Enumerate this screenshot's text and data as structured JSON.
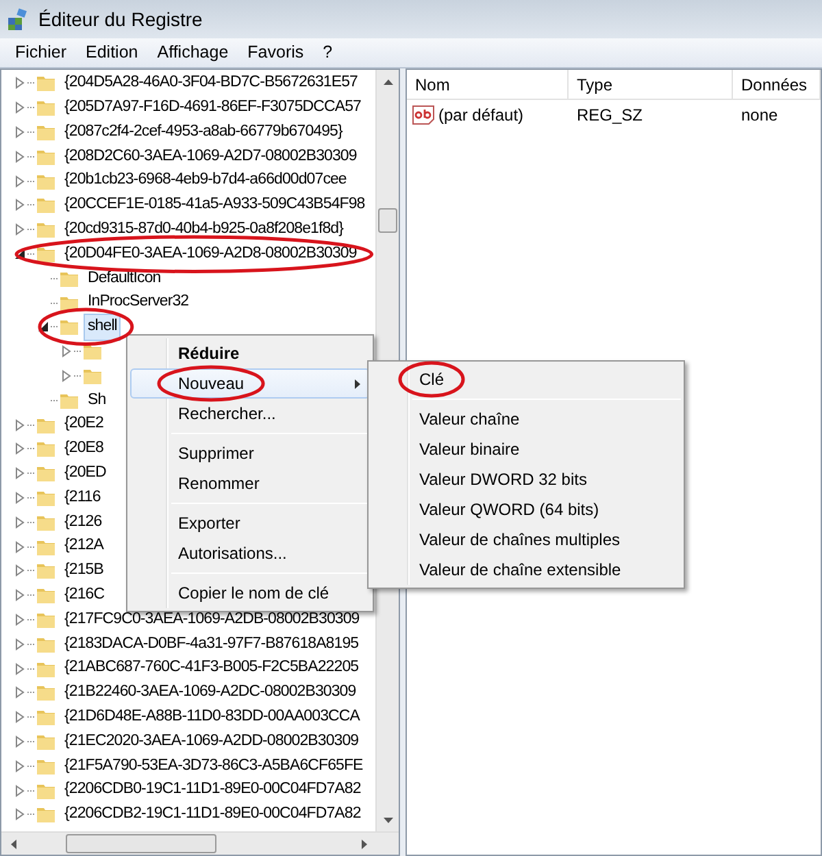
{
  "window": {
    "title": "Éditeur du Registre"
  },
  "menu_bar": [
    "Fichier",
    "Edition",
    "Affichage",
    "Favoris",
    "?"
  ],
  "tree": [
    {
      "label": "{204D5A28-46A0-3F04-BD7C-B5672631E57",
      "expandable": true,
      "expanded": false,
      "selected": false,
      "circled": false
    },
    {
      "label": "{205D7A97-F16D-4691-86EF-F3075DCCA57",
      "expandable": true,
      "expanded": false,
      "selected": false,
      "circled": false
    },
    {
      "label": "{2087c2f4-2cef-4953-a8ab-66779b670495}",
      "expandable": true,
      "expanded": false,
      "selected": false,
      "circled": false
    },
    {
      "label": "{208D2C60-3AEA-1069-A2D7-08002B30309",
      "expandable": true,
      "expanded": false,
      "selected": false,
      "circled": false
    },
    {
      "label": "{20b1cb23-6968-4eb9-b7d4-a66d00d07cee",
      "expandable": true,
      "expanded": false,
      "selected": false,
      "circled": false
    },
    {
      "label": "{20CCEF1E-0185-41a5-A933-509C43B54F98",
      "expandable": true,
      "expanded": false,
      "selected": false,
      "circled": false
    },
    {
      "label": "{20cd9315-87d0-40b4-b925-0a8f208e1f8d}",
      "expandable": true,
      "expanded": false,
      "selected": false,
      "circled": false
    },
    {
      "label": "{20D04FE0-3AEA-1069-A2D8-08002B30309",
      "expandable": true,
      "expanded": true,
      "selected": false,
      "circled": true,
      "children": [
        {
          "label": "DefaultIcon",
          "expandable": false,
          "selected": false,
          "circled": false
        },
        {
          "label": "InProcServer32",
          "expandable": false,
          "selected": false,
          "circled": false
        },
        {
          "label": "shell",
          "expandable": true,
          "expanded": true,
          "selected": true,
          "circled": true,
          "children": [
            {
              "expandable": true,
              "expanded": false
            },
            {
              "expandable": true,
              "expanded": false
            }
          ]
        },
        {
          "label": "Sh",
          "expandable": false,
          "selected": false,
          "circled": false
        }
      ]
    },
    {
      "label": "{20E2",
      "expandable": true,
      "expanded": false,
      "selected": false,
      "circled": false
    },
    {
      "label": "{20E8",
      "expandable": true,
      "expanded": false,
      "selected": false,
      "circled": false
    },
    {
      "label": "{20ED",
      "expandable": true,
      "expanded": false,
      "selected": false,
      "circled": false
    },
    {
      "label": "{2116",
      "expandable": true,
      "expanded": false,
      "selected": false,
      "circled": false
    },
    {
      "label": "{2126",
      "expandable": true,
      "expanded": false,
      "selected": false,
      "circled": false
    },
    {
      "label": "{212A",
      "expandable": true,
      "expanded": false,
      "selected": false,
      "circled": false
    },
    {
      "label": "{215B",
      "expandable": true,
      "expanded": false,
      "selected": false,
      "circled": false
    },
    {
      "label": "{216C",
      "expandable": true,
      "expanded": false,
      "selected": false,
      "circled": false
    },
    {
      "label": "{217FC9C0-3AEA-1069-A2DB-08002B30309",
      "expandable": true,
      "expanded": false,
      "selected": false,
      "circled": false
    },
    {
      "label": "{2183DACA-D0BF-4a31-97F7-B87618A8195",
      "expandable": true,
      "expanded": false,
      "selected": false,
      "circled": false
    },
    {
      "label": "{21ABC687-760C-41F3-B005-F2C5BA22205",
      "expandable": true,
      "expanded": false,
      "selected": false,
      "circled": false
    },
    {
      "label": "{21B22460-3AEA-1069-A2DC-08002B30309",
      "expandable": true,
      "expanded": false,
      "selected": false,
      "circled": false
    },
    {
      "label": "{21D6D48E-A88B-11D0-83DD-00AA003CCA",
      "expandable": true,
      "expanded": false,
      "selected": false,
      "circled": false
    },
    {
      "label": "{21EC2020-3AEA-1069-A2DD-08002B30309",
      "expandable": true,
      "expanded": false,
      "selected": false,
      "circled": false
    },
    {
      "label": "{21F5A790-53EA-3D73-86C3-A5BA6CF65FE",
      "expandable": true,
      "expanded": false,
      "selected": false,
      "circled": false
    },
    {
      "label": "{2206CDB0-19C1-11D1-89E0-00C04FD7A82",
      "expandable": true,
      "expanded": false,
      "selected": false,
      "circled": false
    },
    {
      "label": "{2206CDB2-19C1-11D1-89E0-00C04FD7A82",
      "expandable": true,
      "expanded": false,
      "selected": false,
      "circled": false
    }
  ],
  "values": {
    "columns": [
      "Nom",
      "Type",
      "Données"
    ],
    "rows": [
      {
        "name": "(par défaut)",
        "type": "REG_SZ",
        "data": "none"
      }
    ]
  },
  "context_menu": [
    {
      "kind": "item",
      "label": "Réduire",
      "default": true,
      "highlighted": false,
      "submenu": false,
      "circled": false
    },
    {
      "kind": "item",
      "label": "Nouveau",
      "default": false,
      "highlighted": true,
      "submenu": true,
      "circled": true
    },
    {
      "kind": "item",
      "label": "Rechercher...",
      "default": false,
      "highlighted": false,
      "submenu": false,
      "circled": false
    },
    {
      "kind": "separator"
    },
    {
      "kind": "item",
      "label": "Supprimer",
      "default": false,
      "highlighted": false,
      "submenu": false,
      "circled": false
    },
    {
      "kind": "item",
      "label": "Renommer",
      "default": false,
      "highlighted": false,
      "submenu": false,
      "circled": false
    },
    {
      "kind": "separator"
    },
    {
      "kind": "item",
      "label": "Exporter",
      "default": false,
      "highlighted": false,
      "submenu": false,
      "circled": false
    },
    {
      "kind": "item",
      "label": "Autorisations...",
      "default": false,
      "highlighted": false,
      "submenu": false,
      "circled": false
    },
    {
      "kind": "separator"
    },
    {
      "kind": "item",
      "label": "Copier le nom de clé",
      "default": false,
      "highlighted": false,
      "submenu": false,
      "circled": false
    }
  ],
  "submenu": [
    {
      "kind": "item",
      "label": "Clé",
      "circled": true
    },
    {
      "kind": "separator"
    },
    {
      "kind": "item",
      "label": "Valeur chaîne",
      "circled": false
    },
    {
      "kind": "item",
      "label": "Valeur binaire",
      "circled": false
    },
    {
      "kind": "item",
      "label": "Valeur DWORD 32 bits",
      "circled": false
    },
    {
      "kind": "item",
      "label": "Valeur QWORD (64 bits)",
      "circled": false
    },
    {
      "kind": "item",
      "label": "Valeur de chaînes multiples",
      "circled": false
    },
    {
      "kind": "item",
      "label": "Valeur de chaîne extensible",
      "circled": false
    }
  ]
}
